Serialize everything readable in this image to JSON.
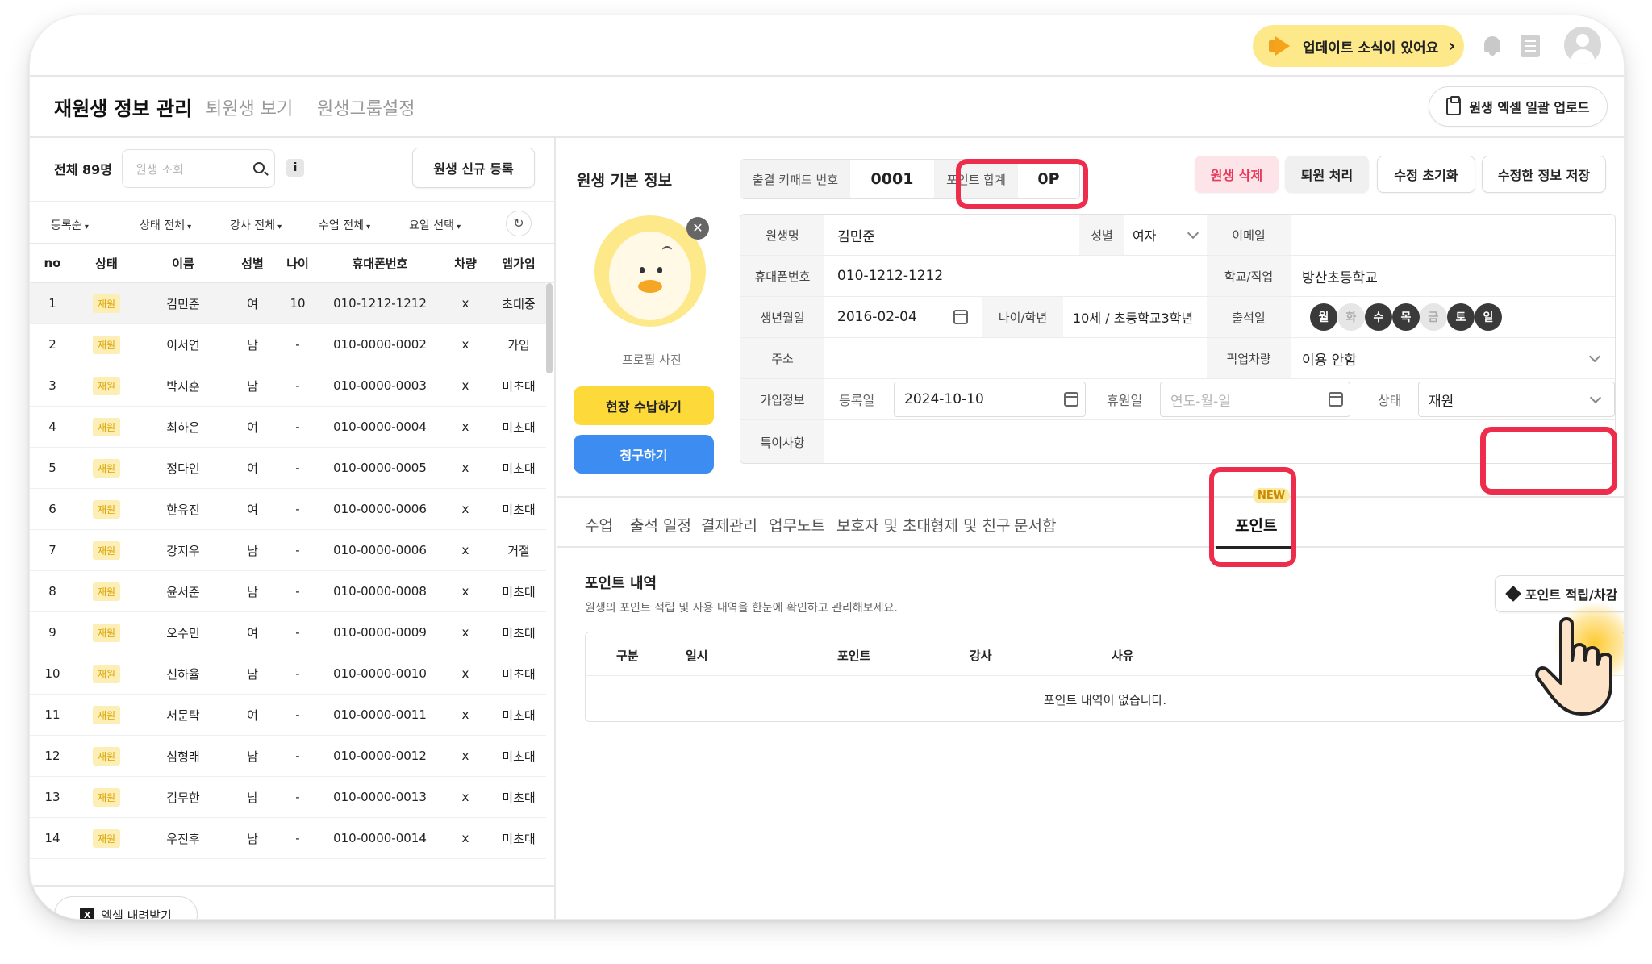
{
  "topbar": {
    "update_label": "업데이트 소식이 있어요",
    "update_chevron": "›",
    "icons": [
      "megaphone-icon",
      "bell-icon",
      "document-icon",
      "avatar-icon"
    ]
  },
  "header": {
    "tabs": [
      "재원생 정보 관리",
      "퇴원생 보기",
      "원생그룹설정"
    ],
    "excel_upload_label": "원생 엑셀 일괄 업로드"
  },
  "left": {
    "total_label": "전체 89명",
    "search_placeholder": "원생 조회",
    "info_label": "i",
    "new_student_label": "원생 신규 등록",
    "filters": [
      "등록순",
      "상태 전체",
      "강사 전체",
      "수업 전체",
      "요일 선택"
    ],
    "columns": [
      "no",
      "상태",
      "이름",
      "성별",
      "나이",
      "휴대폰번호",
      "차량",
      "앱가입"
    ],
    "rows": [
      [
        "1",
        "재원",
        "김민준",
        "여",
        "10",
        "010-1212-1212",
        "x",
        "초대중"
      ],
      [
        "2",
        "재원",
        "이서연",
        "남",
        "-",
        "010-0000-0002",
        "x",
        "가입"
      ],
      [
        "3",
        "재원",
        "박지훈",
        "남",
        "-",
        "010-0000-0003",
        "x",
        "미초대"
      ],
      [
        "4",
        "재원",
        "최하은",
        "여",
        "-",
        "010-0000-0004",
        "x",
        "미초대"
      ],
      [
        "5",
        "재원",
        "정다인",
        "여",
        "-",
        "010-0000-0005",
        "x",
        "미초대"
      ],
      [
        "6",
        "재원",
        "한유진",
        "여",
        "-",
        "010-0000-0006",
        "x",
        "미초대"
      ],
      [
        "7",
        "재원",
        "강지우",
        "남",
        "-",
        "010-0000-0006",
        "x",
        "거절"
      ],
      [
        "8",
        "재원",
        "윤서준",
        "남",
        "-",
        "010-0000-0008",
        "x",
        "미초대"
      ],
      [
        "9",
        "재원",
        "오수민",
        "여",
        "-",
        "010-0000-0009",
        "x",
        "미초대"
      ],
      [
        "10",
        "재원",
        "신하율",
        "남",
        "-",
        "010-0000-0010",
        "x",
        "미초대"
      ],
      [
        "11",
        "재원",
        "서문탁",
        "여",
        "-",
        "010-0000-0011",
        "x",
        "미초대"
      ],
      [
        "12",
        "재원",
        "심형래",
        "남",
        "-",
        "010-0000-0012",
        "x",
        "미초대"
      ],
      [
        "13",
        "재원",
        "김무한",
        "남",
        "-",
        "010-0000-0013",
        "x",
        "미초대"
      ],
      [
        "14",
        "재원",
        "우진후",
        "남",
        "-",
        "010-0000-0014",
        "x",
        "미초대"
      ]
    ],
    "excel_download_label": "엑셀 내려받기",
    "excel_icon_text": "X"
  },
  "right": {
    "section_title": "원생 기본 정보",
    "keypad_label": "출결 키패드 번호",
    "keypad_value": "0001",
    "points_label": "포인트 합계",
    "points_value": "0P",
    "actions": {
      "delete": "원생 삭제",
      "withdraw": "퇴원 처리",
      "reset": "수정 초기화",
      "save": "수정한 정보 저장"
    },
    "profile_label": "프로필 사진",
    "pay_label": "현장 수납하기",
    "bill_label": "청구하기",
    "fields": {
      "name_label": "원생명",
      "name": "김민준",
      "gender_label": "성별",
      "gender": "여자",
      "email_label": "이메일",
      "email": "",
      "phone_label": "휴대폰번호",
      "phone": "010-1212-1212",
      "school_label": "학교/직업",
      "school": "방산초등학교",
      "birth_label": "생년월일",
      "birth": "2016-02-04",
      "age_label": "나이/학년",
      "age": "10세 / 초등학교3학년",
      "attend_label": "출석일",
      "days": [
        "월",
        "화",
        "수",
        "목",
        "금",
        "토",
        "일"
      ],
      "days_on": [
        true,
        false,
        true,
        true,
        false,
        true,
        true
      ],
      "address_label": "주소",
      "address": "",
      "pickup_label": "픽업차량",
      "pickup": "이용 안함",
      "join_label": "가입정보",
      "reg_label": "등록일",
      "reg": "2024-10-10",
      "leave_label": "휴원일",
      "leave_placeholder": "연도-월-일",
      "status_label": "상태",
      "status": "재원",
      "note_label": "특이사항",
      "note": ""
    },
    "tabs": [
      "수업",
      "출석 일정",
      "결제관리",
      "업무노트",
      "보호자 및 초대",
      "형제 및 친구",
      "문서함",
      "포인트"
    ],
    "new_badge": "NEW",
    "points": {
      "title": "포인트 내역",
      "desc": "원생의 포인트 적립 및 사용 내역을 한눈에 확인하고 관리해보세요.",
      "button": "포인트 적립/차감",
      "columns": [
        "구분",
        "일시",
        "포인트",
        "강사",
        "사유"
      ],
      "empty": "포인트 내역이 없습니다."
    }
  },
  "colors": {
    "accent_yellow": "#fdd93a",
    "accent_blue": "#3d8cf1",
    "highlight_red": "#ee2d4d",
    "badge_bg": "#fdeeb5"
  }
}
